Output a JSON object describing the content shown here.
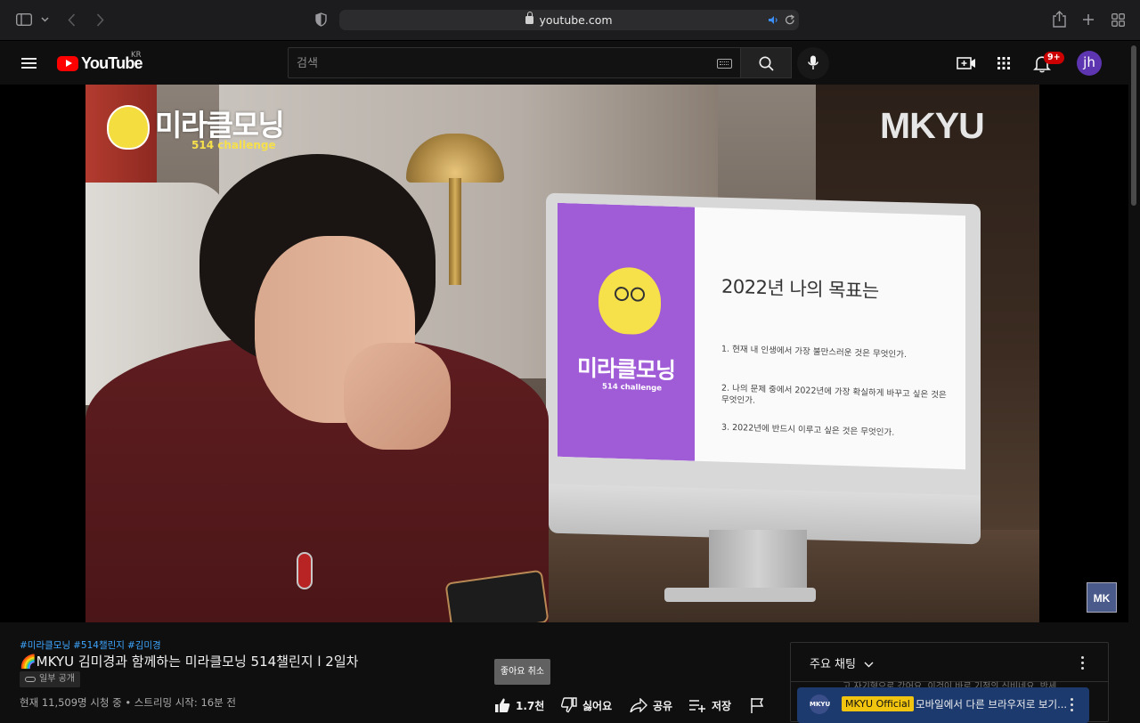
{
  "browser": {
    "url": "youtube.com"
  },
  "header": {
    "logo_text": "YouTube",
    "region": "KR",
    "search_placeholder": "검색",
    "notification_count": "9+",
    "avatar_initials": "jh"
  },
  "player": {
    "overlay_brand_title": "미라클모닝",
    "overlay_brand_subtitle": "514 challenge",
    "channel_logo": "MKYU",
    "watermark": "MK",
    "slide": {
      "logo": "미라클모닝",
      "logo_sub": "514 challenge",
      "title": "2022년 나의 목표는",
      "items": [
        "1. 현재 내 인생에서 가장 불만스러운 것은 무엇인가.",
        "2. 나의 문제 중에서 2022년에 가장 확실하게 바꾸고 싶은 것은 무엇인가.",
        "3. 2022년에 반드시 이루고 싶은 것은 무엇인가."
      ]
    }
  },
  "video": {
    "hashtags": [
      "#미라클모닝",
      "#514챌린지",
      "#김미경"
    ],
    "title": "🌈MKYU 김미경과 함께하는 미라클모닝 514챌린지 l 2일차",
    "privacy": "일부 공개",
    "view_info": "현재 11,509명 시청 중 • 스트리밍 시작: 16분 전"
  },
  "actions": {
    "like_tooltip": "좋아요 취소",
    "like_count": "1.7천",
    "dislike_label": "싫어요",
    "share_label": "공유",
    "save_label": "저장"
  },
  "chat": {
    "title": "주요 채팅",
    "faded_message": "고 자기형으로 갔어요. 이것이 바로 기적의 신비네요, 반세",
    "pinned_author": "MKYU Official",
    "pinned_avatar": "MKYU",
    "pinned_message": "모바일에서 다른 브라우저로 보기..."
  },
  "colors": {
    "accent_red": "#ff0000",
    "link_blue": "#3ea6ff",
    "badge_red": "#cc0000",
    "avatar_purple": "#5e35b1",
    "pinned_bg": "#1d3a6e",
    "author_badge": "#f1c40f"
  }
}
